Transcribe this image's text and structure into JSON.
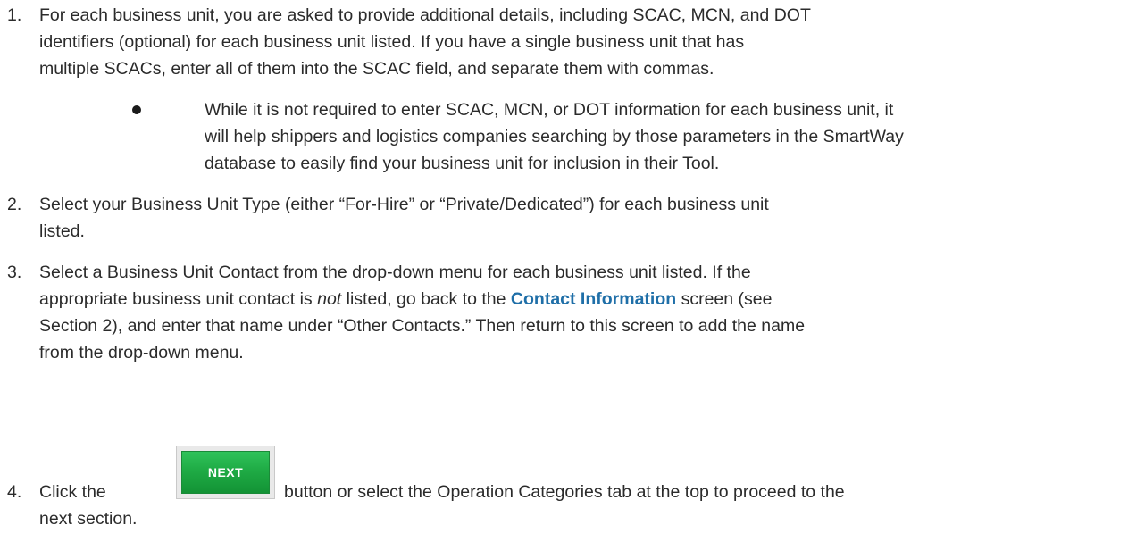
{
  "steps": [
    {
      "number": "1.",
      "lines": [
        "For each business unit, you are asked to provide additional details, including SCAC, MCN, and DOT",
        "identifiers (optional) for each business unit listed.  If you have a single business unit that has",
        "multiple SCACs, enter all of them into the SCAC field, and separate them with commas."
      ],
      "bullet": {
        "lines": [
          "While it is not required to enter SCAC, MCN, or DOT information for each business unit, it",
          "will help shippers and logistics companies searching by those parameters in the SmartWay",
          "database to easily find your business unit for inclusion in their Tool."
        ]
      }
    },
    {
      "number": "2.",
      "lines": [
        "Select your Business Unit Type (either “For-Hire” or “Private/Dedicated”) for each business unit",
        "listed."
      ]
    },
    {
      "number": "3.",
      "line1": "Select a Business Unit Contact from the drop-down menu for each business unit listed.  If the",
      "line2_pre": "appropriate business unit contact is ",
      "line2_emph": "not",
      "line2_mid": " listed, go back to the ",
      "line2_link": "Contact Information",
      "line2_post": " screen (see",
      "line3": "Section 2), and enter that name under “Other Contacts.” Then return to this screen to add the name",
      "line4": "from the drop-down menu."
    },
    {
      "number": "4.",
      "pre": "Click the",
      "button_label": "NEXT",
      "post": "button or select the Operation Categories tab at the top to proceed to the",
      "line2": "next section."
    }
  ],
  "colors": {
    "text": "#2b2b2b",
    "link": "#1f6fa8",
    "button_green": "#1fab45"
  }
}
